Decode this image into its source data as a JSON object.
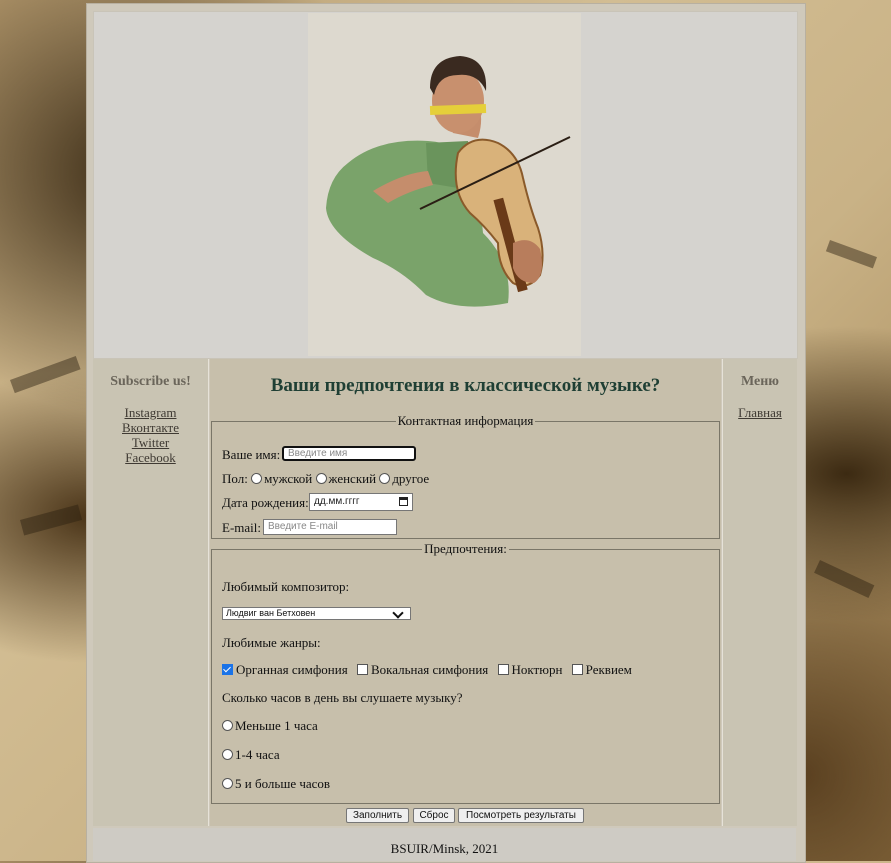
{
  "sidebar_left": {
    "title": "Subscribe us!",
    "links": [
      "Instagram",
      "Вконтакте",
      "Twitter",
      "Facebook"
    ]
  },
  "sidebar_right": {
    "title": "Меню",
    "links": [
      "Главная"
    ]
  },
  "main": {
    "title": "Ваши предпочтения в классической музыке?",
    "contact": {
      "legend": "Контактная информация",
      "name_label": "Ваше имя:",
      "name_placeholder": "Введите имя",
      "gender_label": "Пол:",
      "gender_options": [
        "мужской",
        "женский",
        "другое"
      ],
      "dob_label": "Дата рождения:",
      "dob_value": "дд.мм.гггг",
      "email_label": "E-mail:",
      "email_placeholder": "Введите E-mail"
    },
    "prefs": {
      "legend": "Предпочтения:",
      "composer_label": "Любимый композитор:",
      "composer_selected": "Людвиг ван Бетховен",
      "genres_label": "Любимые жанры:",
      "genres": [
        {
          "label": "Органная симфония",
          "checked": true
        },
        {
          "label": "Вокальная симфония",
          "checked": false
        },
        {
          "label": "Ноктюрн",
          "checked": false
        },
        {
          "label": "Реквием",
          "checked": false
        }
      ],
      "hours_label": "Сколько часов в день вы слушаете музыку?",
      "hours_options": [
        "Меньше 1 часа",
        "1-4 часа",
        "5 и больше часов"
      ]
    },
    "buttons": {
      "fill": "Заполнить",
      "reset": "Сброс",
      "results": "Посмотреть результаты"
    }
  },
  "footer": {
    "text": "BSUIR/Minsk, 2021"
  },
  "colors": {
    "title": "#1f3f34",
    "accent_check": "#1a73e8"
  }
}
